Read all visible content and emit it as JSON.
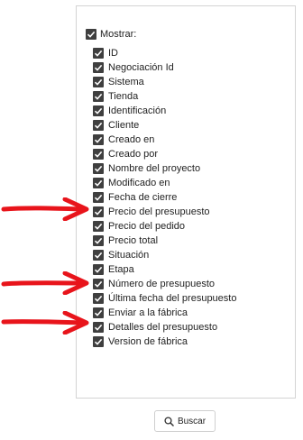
{
  "master": {
    "label": "Mostrar:",
    "checked": true
  },
  "items": [
    {
      "label": "ID",
      "checked": true
    },
    {
      "label": "Negociación Id",
      "checked": true
    },
    {
      "label": "Sistema",
      "checked": true
    },
    {
      "label": "Tienda",
      "checked": true
    },
    {
      "label": "Identificación",
      "checked": true
    },
    {
      "label": "Cliente",
      "checked": true
    },
    {
      "label": "Creado en",
      "checked": true
    },
    {
      "label": "Creado por",
      "checked": true
    },
    {
      "label": "Nombre del proyecto",
      "checked": true
    },
    {
      "label": "Modificado en",
      "checked": true
    },
    {
      "label": "Fecha de cierre",
      "checked": true
    },
    {
      "label": "Precio del presupuesto",
      "checked": true
    },
    {
      "label": "Precio del pedido",
      "checked": true
    },
    {
      "label": "Precio total",
      "checked": true
    },
    {
      "label": "Situación",
      "checked": true
    },
    {
      "label": "Etapa",
      "checked": true
    },
    {
      "label": "Número de presupuesto",
      "checked": true
    },
    {
      "label": "Última fecha del presupuesto",
      "checked": true
    },
    {
      "label": "Enviar a la fábrica",
      "checked": true
    },
    {
      "label": "Detalles del presupuesto",
      "checked": true
    },
    {
      "label": "Version de fábrica",
      "checked": true
    }
  ],
  "arrows": {
    "color": "#e8141b",
    "icon": "red-arrow-annotation"
  },
  "search_button": {
    "label": "Buscar",
    "icon": "search-icon"
  }
}
